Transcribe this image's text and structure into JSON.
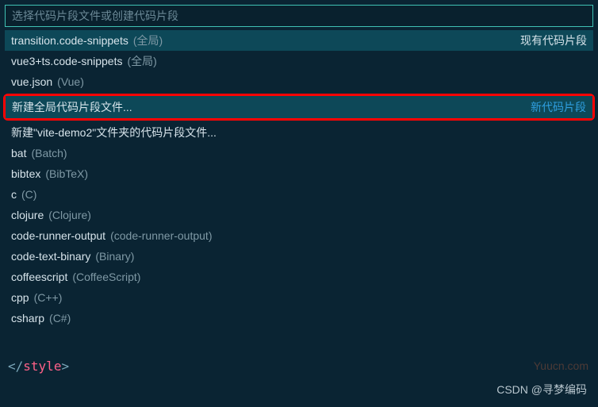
{
  "search": {
    "placeholder": "选择代码片段文件或创建代码片段",
    "value": ""
  },
  "existing_section_badge": "现有代码片段",
  "existing_items": [
    {
      "label": "transition.code-snippets",
      "meta": "(全局)",
      "selected": true,
      "badge": true
    },
    {
      "label": "vue3+ts.code-snippets",
      "meta": "(全局)"
    },
    {
      "label": "vue.json",
      "meta": "(Vue)"
    }
  ],
  "new_section_badge": "新代码片段",
  "highlighted_item": {
    "label": "新建全局代码片段文件..."
  },
  "new_items": [
    {
      "label": "新建\"vite-demo2\"文件夹的代码片段文件..."
    },
    {
      "label": "bat",
      "meta": "(Batch)"
    },
    {
      "label": "bibtex",
      "meta": "(BibTeX)"
    },
    {
      "label": "c",
      "meta": "(C)"
    },
    {
      "label": "clojure",
      "meta": "(Clojure)"
    },
    {
      "label": "code-runner-output",
      "meta": "(code-runner-output)"
    },
    {
      "label": "code-text-binary",
      "meta": "(Binary)"
    },
    {
      "label": "coffeescript",
      "meta": "(CoffeeScript)"
    },
    {
      "label": "cpp",
      "meta": "(C++)"
    },
    {
      "label": "csharp",
      "meta": "(C#)"
    }
  ],
  "code": {
    "lt": "<",
    "slash": "/",
    "tag": "style",
    "gt": ">"
  },
  "watermark": "Yuucn.com",
  "footer": "CSDN @寻梦编码"
}
